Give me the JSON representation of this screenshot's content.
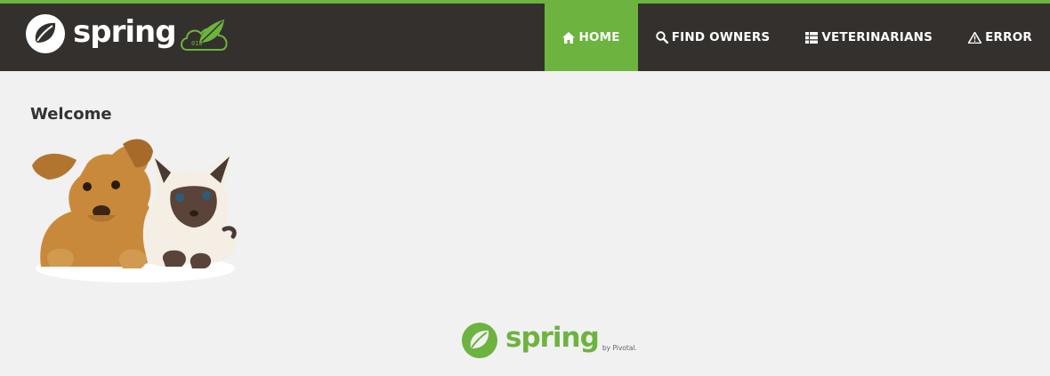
{
  "brand": {
    "wordmark": "spring",
    "badge_icon": "leaf-cloud-icon",
    "logo_icon": "spring-leaf-icon"
  },
  "nav": {
    "items": [
      {
        "label": "HOME",
        "icon": "home-icon",
        "active": true
      },
      {
        "label": "FIND OWNERS",
        "icon": "search-icon",
        "active": false
      },
      {
        "label": "VETERINARIANS",
        "icon": "list-icon",
        "active": false
      },
      {
        "label": "ERROR",
        "icon": "warning-icon",
        "active": false
      }
    ]
  },
  "main": {
    "heading": "Welcome",
    "image": "pets-illustration"
  },
  "footer": {
    "wordmark": "spring",
    "byline": "by Pivotal."
  },
  "colors": {
    "brand_green": "#6db33f",
    "nav_dark": "#34302d",
    "background": "#f1f1f1"
  }
}
